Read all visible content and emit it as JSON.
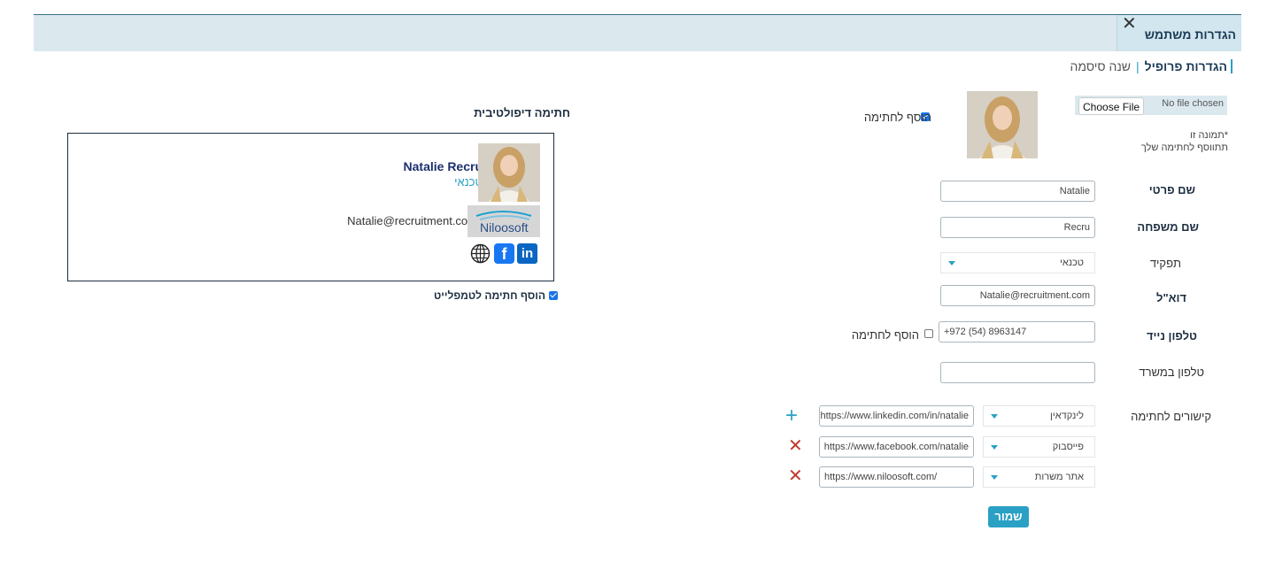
{
  "header": {
    "title": "הגדרות משתמש",
    "close_glyph": "✕"
  },
  "tabs": {
    "profile": "הגדרות פרופיל",
    "change_password": "שנה סיסמה"
  },
  "file_upload": {
    "button": "Choose File",
    "status": "No file chosen"
  },
  "photo_note": {
    "line1": "*תמונה זו",
    "line2": "תתווסף לחתימה שלך"
  },
  "add_photo_to_signature": {
    "label": "הוסף לחתימה",
    "checked": true
  },
  "form": {
    "first_name": {
      "label": "שם פרטי",
      "value": "Natalie"
    },
    "last_name": {
      "label": "שם משפחה",
      "value": "Recru"
    },
    "role": {
      "label": "תפקיד",
      "value": "טכנאי"
    },
    "email": {
      "label": "דוא\"ל",
      "value": "Natalie@recruitment.com"
    },
    "mobile": {
      "label": "טלפון נייד",
      "value": "+972 (54) 8963147",
      "add_label": "הוסף לחתימה",
      "add_checked": false
    },
    "office_phone": {
      "label": "טלפון במשרד",
      "value": ""
    },
    "links": {
      "label": "קישורים לחתימה",
      "items": [
        {
          "type": "לינקדאין",
          "url": "https://www.linkedin.com/in/natalie",
          "action": "add-icon"
        },
        {
          "type": "פייסבוק",
          "url": "https://www.facebook.com/natalie",
          "action": "remove-icon"
        },
        {
          "type": "אתר משרות",
          "url": "https://www.niloosoft.com/",
          "action": "remove-icon"
        }
      ]
    },
    "save": "שמור"
  },
  "signature": {
    "title": "חתימה דיפולטיבית",
    "name": "Natalie Recru",
    "role": "טכנאי",
    "email": "Natalie@recruitment.com",
    "logo_text": "Niloosoft",
    "icons": [
      "globe-icon",
      "facebook-icon",
      "linkedin-icon"
    ],
    "add_to_template": {
      "label": "הוסף חתימה לטמפלייט",
      "checked": true
    }
  },
  "colors": {
    "accent": "#2aa0c5",
    "header_bg": "#dbe9ef",
    "remove": "#c0392b",
    "name": "#1c2e6e"
  }
}
